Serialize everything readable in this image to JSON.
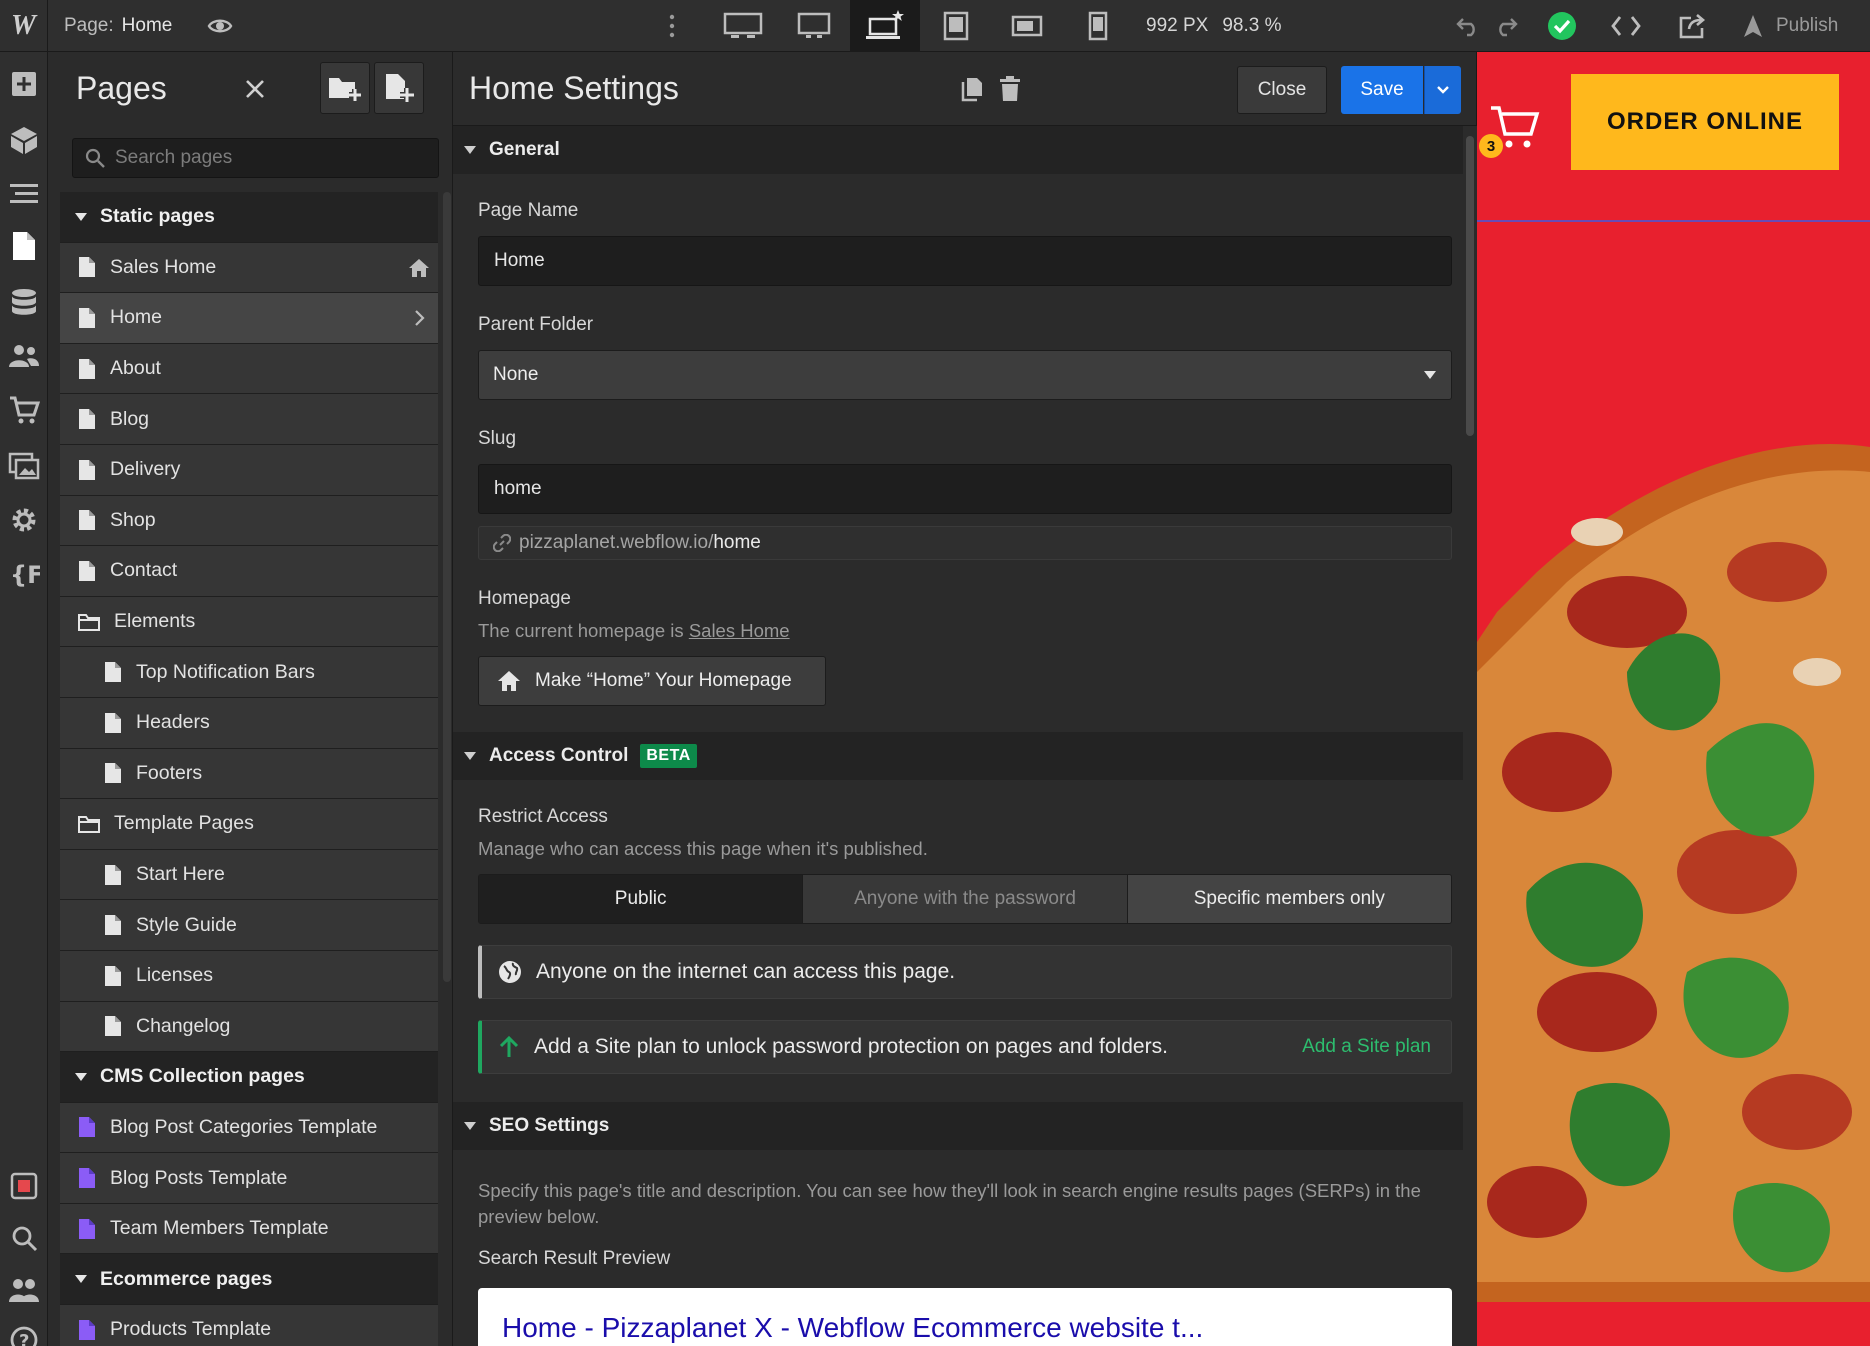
{
  "topbar": {
    "logo": "W",
    "page_label": "Page:",
    "page_value": "Home",
    "width_px": "992 PX",
    "zoom": "98.3 %",
    "publish_label": "Publish"
  },
  "pages_panel": {
    "title": "Pages",
    "search_placeholder": "Search pages",
    "rows": [
      {
        "label": "Static pages",
        "kind": "group"
      },
      {
        "label": "Sales Home",
        "kind": "page",
        "home": true
      },
      {
        "label": "Home",
        "kind": "page",
        "selected": true
      },
      {
        "label": "About",
        "kind": "page"
      },
      {
        "label": "Blog",
        "kind": "page"
      },
      {
        "label": "Delivery",
        "kind": "page"
      },
      {
        "label": "Shop",
        "kind": "page"
      },
      {
        "label": "Contact",
        "kind": "page"
      },
      {
        "label": "Elements",
        "kind": "folder"
      },
      {
        "label": "Top Notification Bars",
        "kind": "subpage"
      },
      {
        "label": "Headers",
        "kind": "subpage"
      },
      {
        "label": "Footers",
        "kind": "subpage"
      },
      {
        "label": "Template Pages",
        "kind": "folder"
      },
      {
        "label": "Start Here",
        "kind": "subpage"
      },
      {
        "label": "Style Guide",
        "kind": "subpage"
      },
      {
        "label": "Licenses",
        "kind": "subpage"
      },
      {
        "label": "Changelog",
        "kind": "subpage"
      },
      {
        "label": "CMS Collection pages",
        "kind": "group"
      },
      {
        "label": "Blog Post Categories Template",
        "kind": "cms"
      },
      {
        "label": "Blog Posts Template",
        "kind": "cms"
      },
      {
        "label": "Team Members Template",
        "kind": "cms"
      },
      {
        "label": "Ecommerce pages",
        "kind": "group"
      },
      {
        "label": "Products Template",
        "kind": "cms"
      }
    ]
  },
  "settings": {
    "title": "Home Settings",
    "close_label": "Close",
    "save_label": "Save",
    "general": {
      "heading": "General",
      "page_name_label": "Page Name",
      "page_name_value": "Home",
      "parent_folder_label": "Parent Folder",
      "parent_folder_value": "None",
      "slug_label": "Slug",
      "slug_value": "home",
      "url_prefix": "pizzaplanet.webflow.io/",
      "url_slug": "home",
      "homepage_label": "Homepage",
      "homepage_text": "The current homepage is",
      "homepage_link": "Sales Home",
      "make_home_button": "Make “Home” Your Homepage"
    },
    "access": {
      "heading": "Access Control",
      "badge": "BETA",
      "restrict_label": "Restrict Access",
      "restrict_desc": "Manage who can access this page when it's published.",
      "options": [
        "Public",
        "Anyone with the password",
        "Specific members only"
      ],
      "notice_public": "Anyone on the internet can access this page.",
      "notice_upgrade": "Add a Site plan to unlock password protection on pages and folders.",
      "upgrade_link": "Add a Site plan"
    },
    "seo": {
      "heading": "SEO Settings",
      "desc": "Specify this page's title and description. You can see how they'll look in search engine results pages (SERPs) in the preview below.",
      "preview_label": "Search Result Preview",
      "preview_title": "Home - Pizzaplanet X - Webflow Ecommerce website t..."
    }
  },
  "canvas": {
    "cart_count": "3",
    "order_button": "ORDER ONLINE",
    "colors": {
      "background": "#e8202e",
      "button": "#ffb81c"
    }
  },
  "colors": {
    "accent": "#1a73e8",
    "success": "#1fa860",
    "cms_page_icon": "#8b5cf6"
  }
}
